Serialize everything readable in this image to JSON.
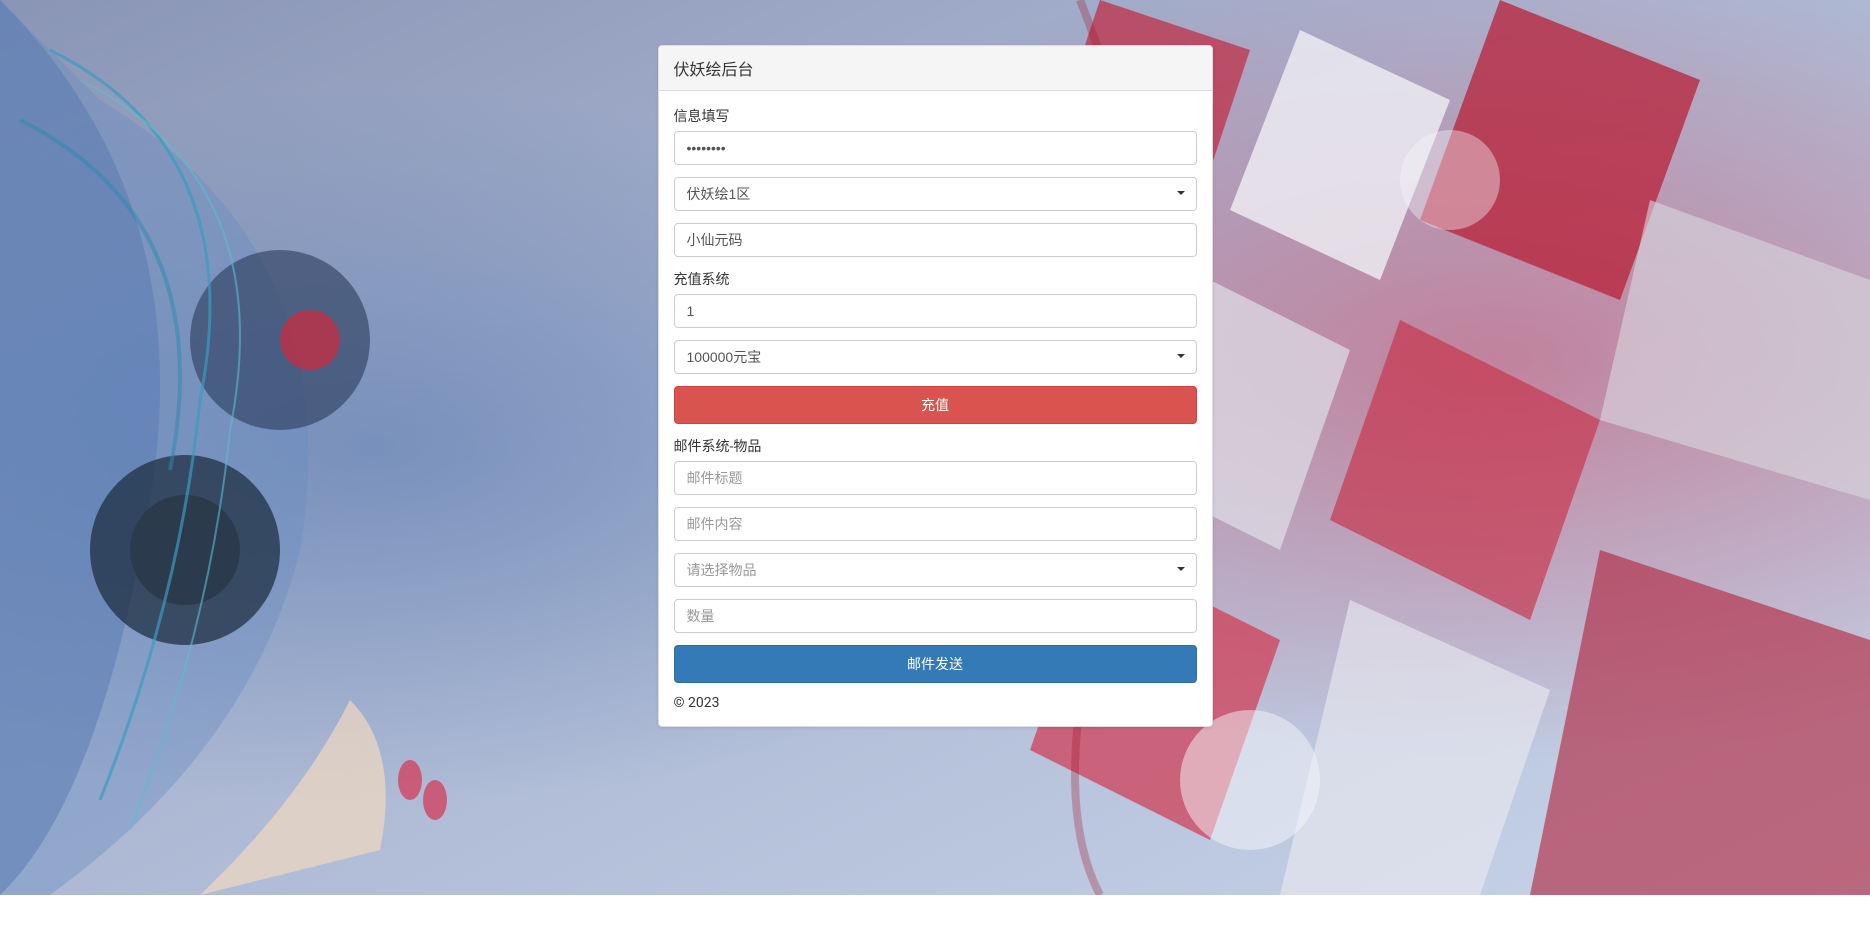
{
  "header": {
    "title": "伏妖绘后台"
  },
  "info_section": {
    "label": "信息填写",
    "password_value": "••••••••",
    "server_selected": "伏妖绘1区",
    "character_value": "小仙元码"
  },
  "recharge_section": {
    "label": "充值系统",
    "amount_value": "1",
    "currency_selected": "100000元宝",
    "button_label": "充值"
  },
  "mail_section": {
    "label": "邮件系统-物品",
    "title_placeholder": "邮件标题",
    "content_placeholder": "邮件内容",
    "item_selected": "请选择物品",
    "quantity_placeholder": "数量",
    "button_label": "邮件发送"
  },
  "footer": {
    "copyright": "© 2023"
  }
}
